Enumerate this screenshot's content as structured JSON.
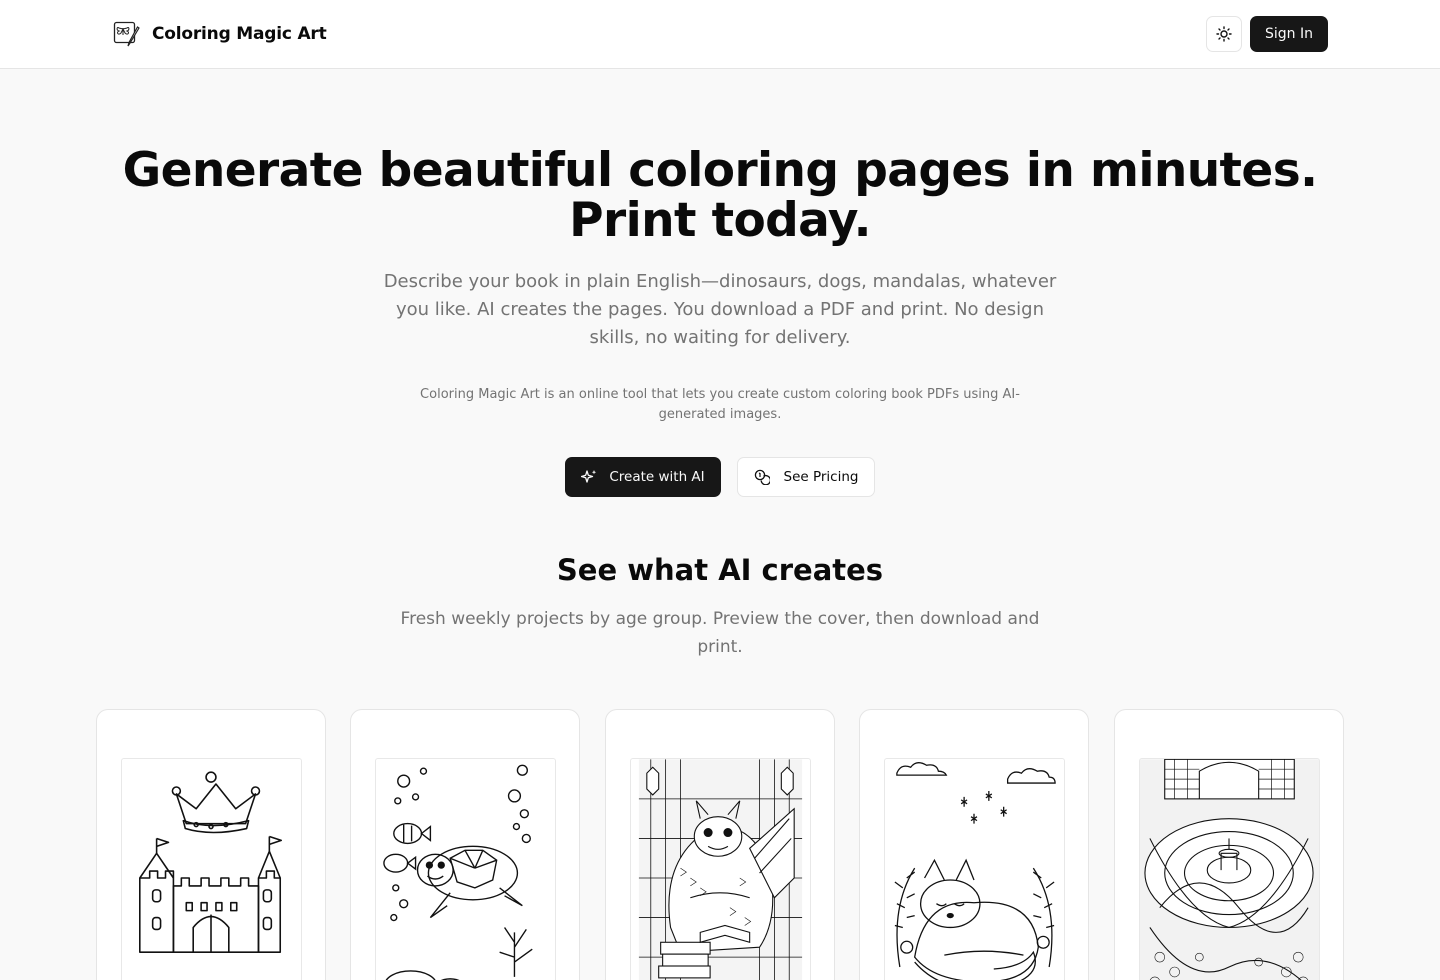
{
  "header": {
    "brand_name": "Coloring Magic Art",
    "sign_in_label": "Sign In"
  },
  "hero": {
    "title": "Generate beautiful coloring pages in minutes. Print today.",
    "subtitle": "Describe your book in plain English—dinosaurs, dogs, mandalas, whatever you like. AI creates the pages. You download a PDF and print. No design skills, no waiting for delivery.",
    "note": "Coloring Magic Art is an online tool that lets you create custom coloring book PDFs using AI-generated images.",
    "create_label": "Create with AI",
    "pricing_label": "See Pricing"
  },
  "showcase": {
    "title": "See what AI creates",
    "subtitle": "Fresh weekly projects by age group. Preview the cover, then download and print.",
    "cards": [
      {
        "icon": "castle-crown-drawing"
      },
      {
        "icon": "sea-turtle-drawing"
      },
      {
        "icon": "dragon-books-drawing"
      },
      {
        "icon": "sleeping-fox-drawing"
      },
      {
        "icon": "garden-fountain-maze-drawing"
      }
    ]
  },
  "colors": {
    "background": "#f9f9f9",
    "primary": "#171717",
    "muted_text": "#737373",
    "border": "#e5e5e5"
  }
}
